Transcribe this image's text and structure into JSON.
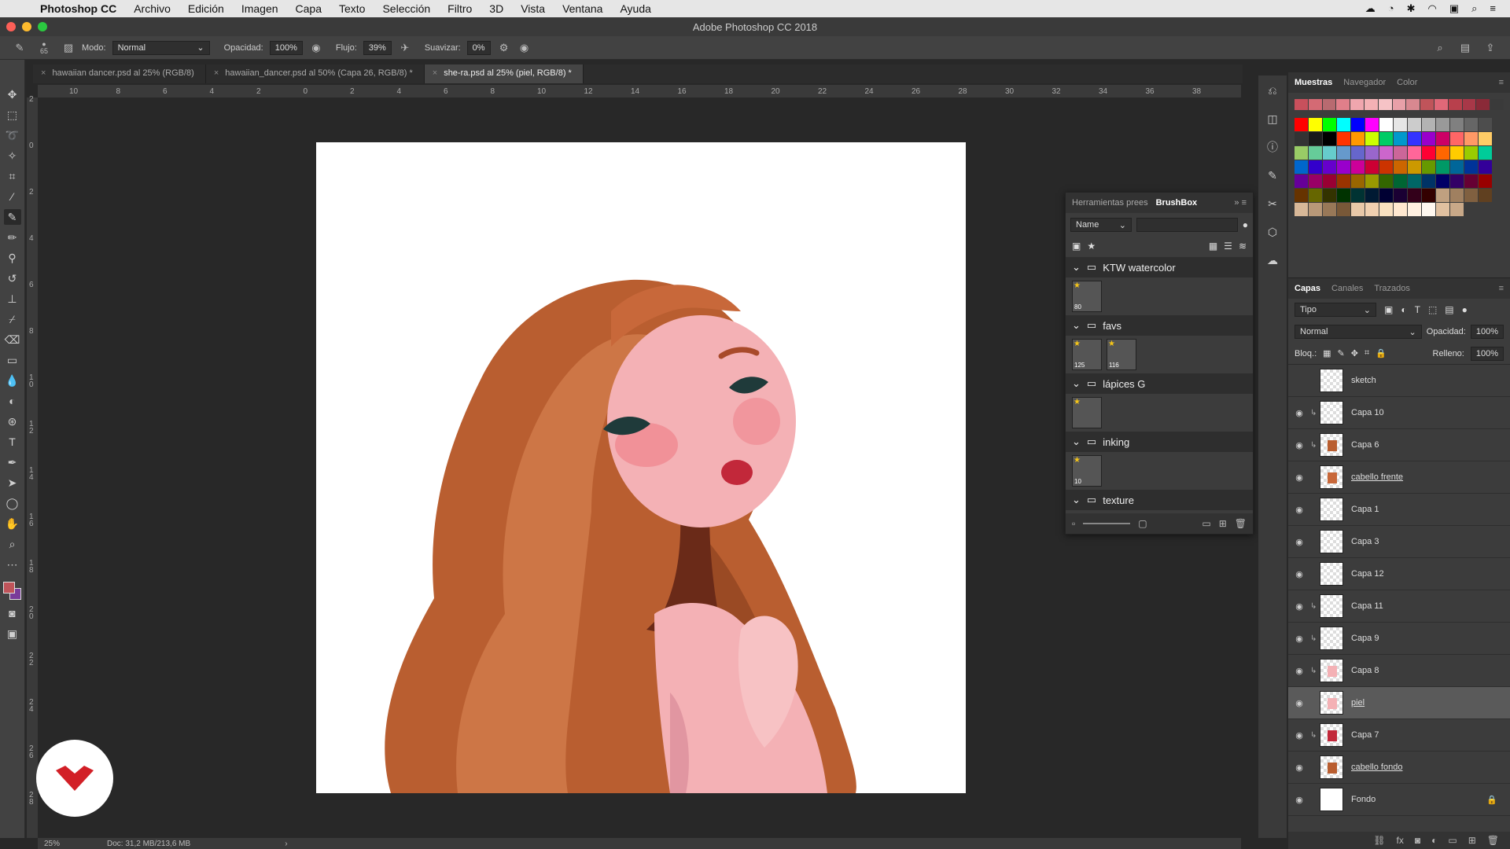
{
  "menubar": {
    "app_name": "Photoshop CC",
    "items": [
      "Archivo",
      "Edición",
      "Imagen",
      "Capa",
      "Texto",
      "Selección",
      "Filtro",
      "3D",
      "Vista",
      "Ventana",
      "Ayuda"
    ]
  },
  "window": {
    "title": "Adobe Photoshop CC 2018"
  },
  "options": {
    "brush_size": "65",
    "mode_label": "Modo:",
    "mode_value": "Normal",
    "opacity_label": "Opacidad:",
    "opacity_value": "100%",
    "flow_label": "Flujo:",
    "flow_value": "39%",
    "smooth_label": "Suavizar:",
    "smooth_value": "0%"
  },
  "doc_tabs": [
    {
      "label": "hawaiian dancer.psd al 25% (RGB/8)"
    },
    {
      "label": "hawaiian_dancer.psd al 50% (Capa 26, RGB/8) *"
    },
    {
      "label": "she-ra.psd al 25% (piel, RGB/8) *"
    }
  ],
  "ruler_top": [
    "10",
    "8",
    "6",
    "4",
    "2",
    "0",
    "2",
    "4",
    "6",
    "8",
    "10",
    "12",
    "14",
    "16",
    "18",
    "20",
    "22",
    "24",
    "26",
    "28",
    "30",
    "32",
    "34",
    "36",
    "38"
  ],
  "ruler_left": [
    "2",
    "0",
    "2",
    "4",
    "6",
    "8",
    "1 0",
    "1 2",
    "1 4",
    "1 6",
    "1 8",
    "2 0",
    "2 2",
    "2 4",
    "2 6",
    "2 8"
  ],
  "status": {
    "zoom": "25%",
    "doc_info": "Doc: 31,2 MB/213,6 MB"
  },
  "colors": {
    "foreground": "#c0545a",
    "background": "#7a3b9a",
    "hair": "#b5582c",
    "skin": "#f4b1b5"
  },
  "brushbox": {
    "tab_presets": "Herramientas prees",
    "tab_brushbox": "BrushBox",
    "search_label": "Name",
    "groups": [
      {
        "name": "KTW watercolor",
        "brushes": [
          {
            "size": "80",
            "starred": true
          }
        ]
      },
      {
        "name": "favs",
        "brushes": [
          {
            "size": "125",
            "starred": true
          },
          {
            "size": "116",
            "starred": true
          }
        ]
      },
      {
        "name": "lápices G",
        "brushes": [
          {
            "size": "",
            "starred": true
          }
        ]
      },
      {
        "name": "inking",
        "brushes": [
          {
            "size": "10",
            "starred": true
          }
        ]
      },
      {
        "name": "texture",
        "brushes": []
      }
    ]
  },
  "swatches_panel": {
    "tabs": [
      "Muestras",
      "Navegador",
      "Color"
    ],
    "recent": [
      "#c8505c",
      "#d46a74",
      "#b86a70",
      "#e07f8a",
      "#f0a6ae",
      "#f4b1b5",
      "#f6c3c6",
      "#e8a0a8",
      "#d88890",
      "#c0545a",
      "#e06878",
      "#b8404c",
      "#a83848",
      "#8a2a38",
      "#3a3a3a"
    ],
    "grid": [
      "#ff0000",
      "#ffff00",
      "#00ff00",
      "#00ffff",
      "#0000ff",
      "#ff00ff",
      "#ffffff",
      "#e6e6e6",
      "#cccccc",
      "#b3b3b3",
      "#999999",
      "#808080",
      "#666666",
      "#4d4d4d",
      "#333333",
      "#1a1a1a",
      "#000000",
      "#ff3300",
      "#ff9900",
      "#ccff00",
      "#00cc66",
      "#0099cc",
      "#3333ff",
      "#9900cc",
      "#cc0066",
      "#ff6666",
      "#ff9966",
      "#ffcc66",
      "#99cc66",
      "#66cc99",
      "#66cccc",
      "#6699cc",
      "#6666cc",
      "#9966cc",
      "#cc66cc",
      "#cc6699",
      "#ff6699",
      "#ff0033",
      "#ff6600",
      "#ffcc00",
      "#99cc00",
      "#00cc99",
      "#0066cc",
      "#3300cc",
      "#6600cc",
      "#9900cc",
      "#cc0099",
      "#cc0033",
      "#cc3300",
      "#cc6600",
      "#cc9900",
      "#669900",
      "#009966",
      "#006699",
      "#003399",
      "#330099",
      "#660099",
      "#990066",
      "#990033",
      "#993300",
      "#996600",
      "#999900",
      "#336600",
      "#006633",
      "#006666",
      "#003366",
      "#000066",
      "#330066",
      "#660033",
      "#990000",
      "#663300",
      "#666600",
      "#333300",
      "#003300",
      "#003333",
      "#001a33",
      "#000033",
      "#1a0033",
      "#33001a",
      "#330000",
      "#c0a080",
      "#a08060",
      "#806040",
      "#604020",
      "#d8b898",
      "#b89878",
      "#987858",
      "#785838",
      "#e8c8a8",
      "#f0d0b0",
      "#f8e0c0",
      "#ffe8d0",
      "#fff0e0",
      "#fff8f0",
      "#e0c0a0",
      "#c8a888"
    ]
  },
  "layers_panel": {
    "tabs": [
      "Capas",
      "Canales",
      "Trazados"
    ],
    "filter_label": "Tipo",
    "blend_mode": "Normal",
    "opacity_label": "Opacidad:",
    "opacity_value": "100%",
    "lock_label": "Bloq.:",
    "fill_label": "Relleno:",
    "fill_value": "100%",
    "layers": [
      {
        "name": "sketch",
        "visible": false,
        "clipped": false,
        "link": false,
        "selected": false
      },
      {
        "name": "Capa 10",
        "visible": true,
        "clipped": true,
        "link": false,
        "selected": false
      },
      {
        "name": "Capa 6",
        "visible": true,
        "clipped": true,
        "link": false,
        "selected": false
      },
      {
        "name": "cabello frente",
        "visible": true,
        "clipped": false,
        "link": true,
        "selected": false
      },
      {
        "name": "Capa 1",
        "visible": true,
        "clipped": false,
        "link": false,
        "selected": false
      },
      {
        "name": "Capa 3",
        "visible": true,
        "clipped": false,
        "link": false,
        "selected": false
      },
      {
        "name": "Capa 12",
        "visible": true,
        "clipped": false,
        "link": false,
        "selected": false
      },
      {
        "name": "Capa 11",
        "visible": true,
        "clipped": true,
        "link": false,
        "selected": false
      },
      {
        "name": "Capa 9",
        "visible": true,
        "clipped": true,
        "link": false,
        "selected": false
      },
      {
        "name": "Capa 8",
        "visible": true,
        "clipped": true,
        "link": false,
        "selected": false
      },
      {
        "name": "piel",
        "visible": true,
        "clipped": false,
        "link": true,
        "selected": true
      },
      {
        "name": "Capa 7",
        "visible": true,
        "clipped": true,
        "link": false,
        "selected": false
      },
      {
        "name": "cabello fondo",
        "visible": true,
        "clipped": false,
        "link": true,
        "selected": false
      },
      {
        "name": "Fondo",
        "visible": true,
        "clipped": false,
        "link": false,
        "selected": false,
        "locked": true
      }
    ]
  }
}
